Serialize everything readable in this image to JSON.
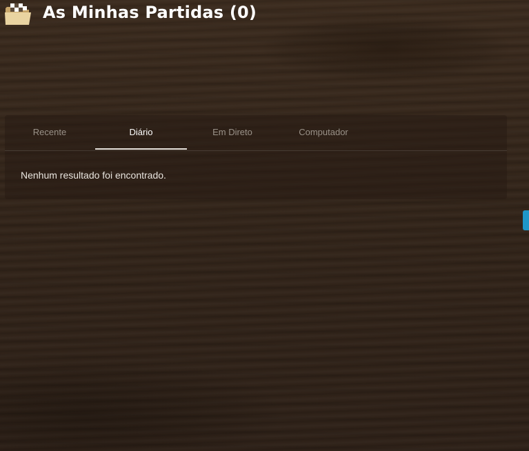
{
  "header": {
    "icon": "folder-open-icon",
    "title": "As Minhas Partidas (0)"
  },
  "tabs": [
    {
      "label": "Recente",
      "active": false
    },
    {
      "label": "Diário",
      "active": true
    },
    {
      "label": "Em Direto",
      "active": false
    },
    {
      "label": "Computador",
      "active": false
    }
  ],
  "results": {
    "empty_message": "Nenhum resultado foi encontrado."
  },
  "colors": {
    "accent": "#1e96c8",
    "text_primary": "#ffffff",
    "text_muted": "#9a9289",
    "background": "#3a2a1d"
  }
}
